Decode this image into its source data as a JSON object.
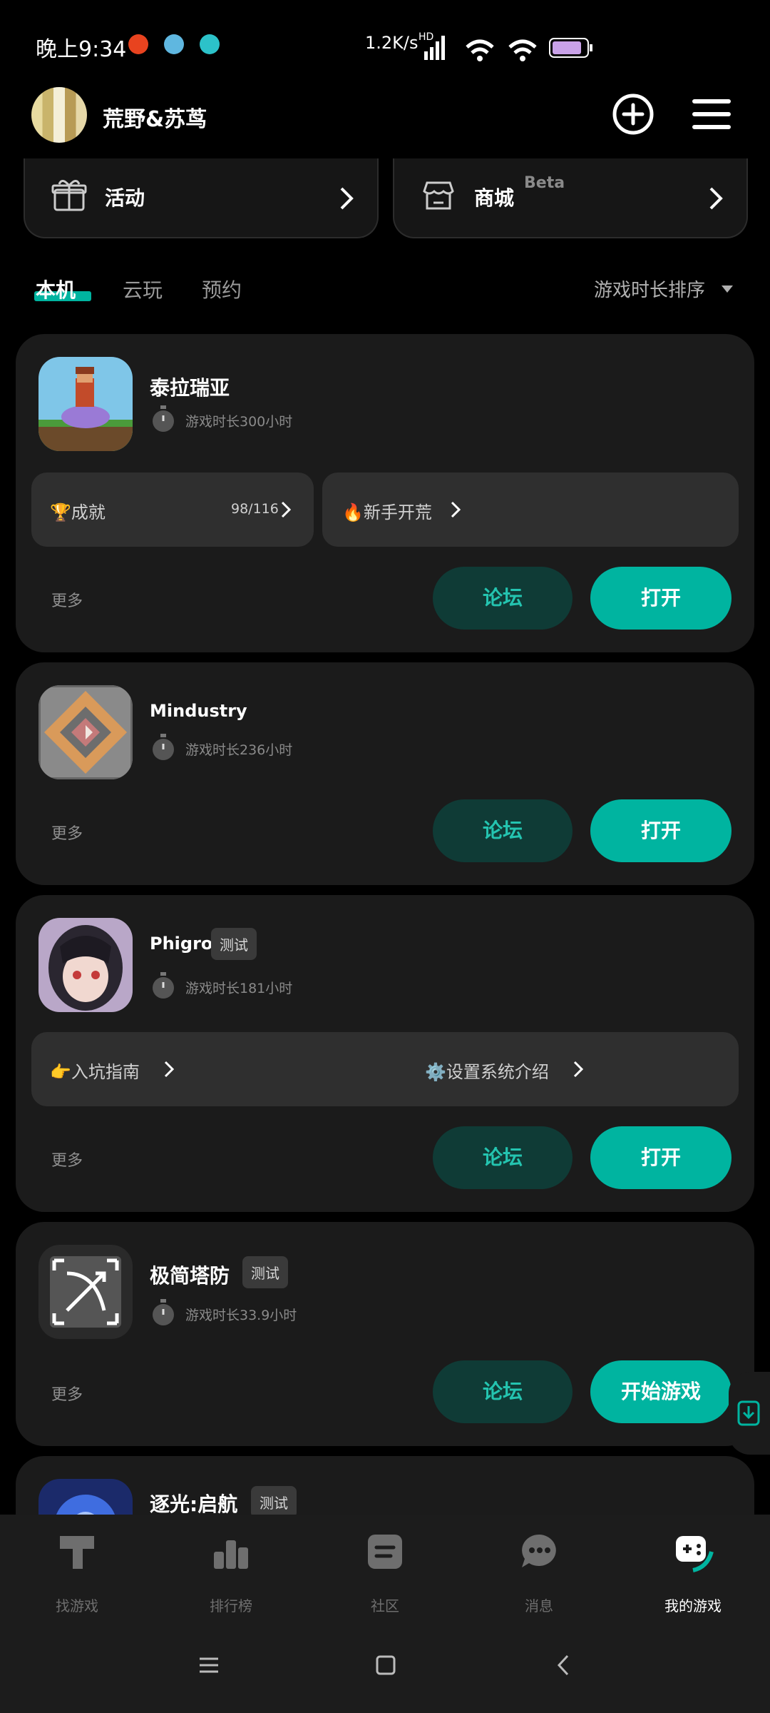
{
  "status_bar": {
    "time": "晚上9:34",
    "net_speed": "1.2K/s",
    "network": "HD",
    "battery": "74"
  },
  "header": {
    "username": "荒野&苏茑"
  },
  "quick_links": [
    {
      "label": "活动",
      "icon": "gift-icon"
    },
    {
      "label": "商城",
      "badge": "Beta",
      "icon": "shop-icon"
    }
  ],
  "tabs": [
    {
      "label": "本机",
      "active": true
    },
    {
      "label": "云玩",
      "active": false
    },
    {
      "label": "预约",
      "active": false
    }
  ],
  "sort_label": "游戏时长排序",
  "games": [
    {
      "name": "泰拉瑞亚",
      "playtime": "游戏时长300小时",
      "strip": {
        "left": "🏆成就",
        "left_value": "98/116",
        "right": "🔥新手开荒"
      },
      "more": "更多",
      "forum": "论坛",
      "action": "打开"
    },
    {
      "name": "Mindustry",
      "playtime": "游戏时长236小时",
      "more": "更多",
      "forum": "论坛",
      "action": "打开"
    },
    {
      "name": "Phigros",
      "badge": "测试",
      "playtime": "游戏时长181小时",
      "strip": {
        "left": "👉入坑指南",
        "right": "⚙️设置系统介绍"
      },
      "more": "更多",
      "forum": "论坛",
      "action": "打开"
    },
    {
      "name": "极简塔防",
      "badge": "测试",
      "playtime": "游戏时长33.9小时",
      "more": "更多",
      "forum": "论坛",
      "action": "开始游戏"
    },
    {
      "name": "逐光:启航",
      "badge": "测试"
    }
  ],
  "bottom_nav": [
    {
      "label": "找游戏",
      "icon": "find-games-icon",
      "active": false
    },
    {
      "label": "排行榜",
      "icon": "leaderboard-icon",
      "active": false
    },
    {
      "label": "社区",
      "icon": "community-icon",
      "active": false
    },
    {
      "label": "消息",
      "icon": "messages-icon",
      "active": false
    },
    {
      "label": "我的游戏",
      "icon": "my-games-icon",
      "active": true
    }
  ],
  "colors": {
    "accent": "#00b4a0",
    "forum_bg": "#0f3b36",
    "card_bg": "#1b1b1b"
  }
}
